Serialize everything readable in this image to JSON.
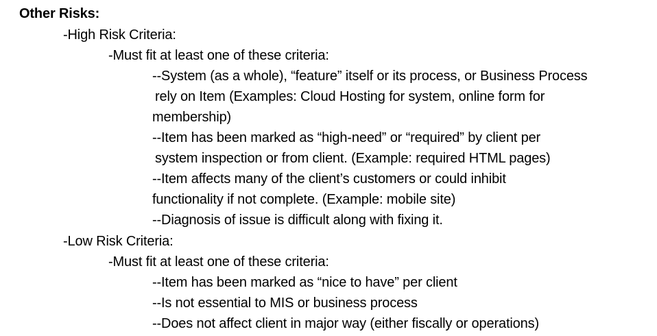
{
  "heading": "Other Risks:",
  "high_risk": {
    "title": "-High Risk Criteria:",
    "subtitle": "-Must fit at least one of these criteria:",
    "items": [
      "--System (as a whole), “feature” itself or its process, or Business Process",
      "rely on Item (Examples: Cloud Hosting for system, online form for",
      "membership)",
      "--Item has been marked as “high-need” or “required” by client per",
      "system inspection or from client. (Example: required HTML pages)",
      "--Item affects many of the client’s customers or could inhibit",
      "functionality if not complete. (Example: mobile site)",
      "--Diagnosis of issue is difficult along with fixing it."
    ]
  },
  "low_risk": {
    "title": "-Low Risk Criteria:",
    "subtitle": "-Must fit at least one of these criteria:",
    "items": [
      "--Item has been marked as “nice to have” per client",
      "--Is not essential to MIS or business process",
      "--Does not affect client in major way (either fiscally or operations)"
    ]
  }
}
